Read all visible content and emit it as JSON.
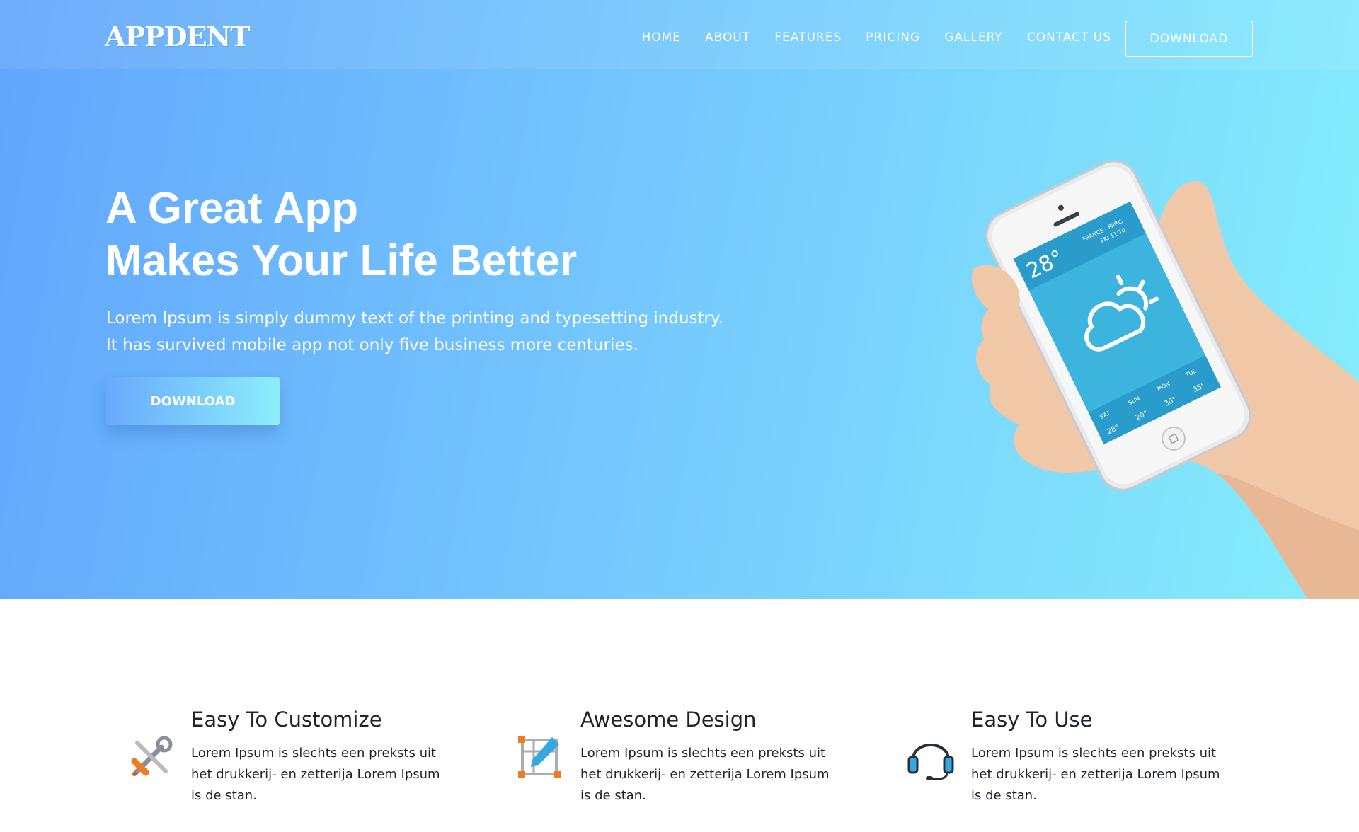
{
  "brand": {
    "logo_text": "APPDENT"
  },
  "nav": {
    "items": [
      "HOME",
      "ABOUT",
      "FEATURES",
      "PRICING",
      "GALLERY",
      "CONTACT US"
    ],
    "download_label": "DOWNLOAD"
  },
  "hero": {
    "headline_line1": "A Great App",
    "headline_line2": "Makes Your Life Better",
    "subtext_line1": "Lorem Ipsum is simply dummy text of the printing and typesetting industry.",
    "subtext_line2": "It has survived mobile app not only five business more centuries.",
    "download_label": "DOWNLOAD"
  },
  "phone_screen": {
    "temperature": "28°",
    "location": "FRANCE - PARIS",
    "date": "FRI 11/10",
    "forecast": [
      {
        "day": "SAT",
        "temp": "28°"
      },
      {
        "day": "SUN",
        "temp": "20°"
      },
      {
        "day": "MON",
        "temp": "30°"
      },
      {
        "day": "TUE",
        "temp": "35°"
      }
    ]
  },
  "features": [
    {
      "title": "Easy To Customize",
      "text": "Lorem Ipsum is slechts een preksts uit het drukkerij- en zetterija Lorem Ipsum is de stan.",
      "icon": "tools-icon"
    },
    {
      "title": "Awesome Design",
      "text": "Lorem Ipsum is slechts een preksts uit het drukkerij- en zetterija Lorem Ipsum is de stan.",
      "icon": "design-pencil-icon"
    },
    {
      "title": "Easy To Use",
      "text": "Lorem Ipsum is slechts een preksts uit het drukkerij- en zetterija Lorem Ipsum is de stan.",
      "icon": "headset-icon"
    }
  ],
  "colors": {
    "gradient_start": "#62a6fc",
    "gradient_end": "#85eefc",
    "text_dark": "#1f2330"
  }
}
